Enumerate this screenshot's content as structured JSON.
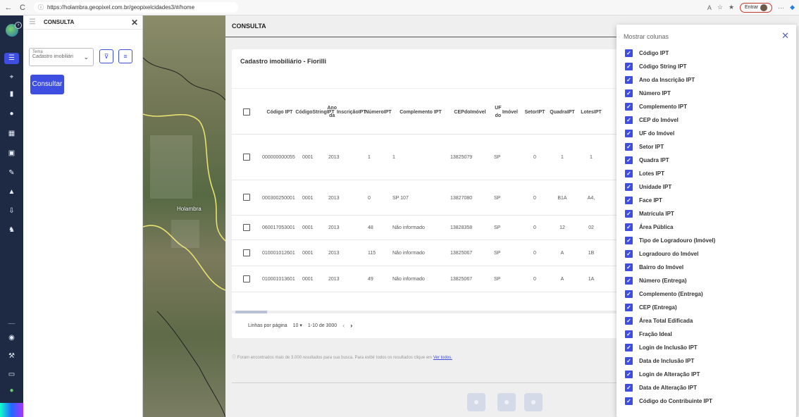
{
  "browser": {
    "url": "https://holambra.geopixel.com.br/geopixelcidades3/#/home",
    "sign_in_label": "Entrar",
    "more_label": "···"
  },
  "panel": {
    "title": "CONSULTA",
    "tema_label": "Tema",
    "tema_value": "Cadastro imobiliári",
    "consult_button": "Consultar"
  },
  "map": {
    "place_label": "Holambra"
  },
  "main": {
    "title": "CONSULTA",
    "card_title": "Cadastro imobiliário - Fiorilli",
    "columns": [
      {
        "lines": [
          "Código IPT"
        ]
      },
      {
        "lines": [
          "Código",
          "String",
          "IPT"
        ]
      },
      {
        "lines": [
          "Ano da",
          "Inscrição",
          "IPT"
        ]
      },
      {
        "lines": [
          "Número",
          "IPT"
        ]
      },
      {
        "lines": [
          "Complemento IPT"
        ]
      },
      {
        "lines": [
          "CEP",
          "do",
          "Imóvel"
        ]
      },
      {
        "lines": [
          "UF do",
          "Imóvel"
        ]
      },
      {
        "lines": [
          "Setor",
          "IPT"
        ]
      },
      {
        "lines": [
          "Quadra",
          "IPT"
        ]
      },
      {
        "lines": [
          "Lotes",
          "IPT"
        ]
      }
    ],
    "rows": [
      [
        "000000000055",
        "0001",
        "2013",
        "1",
        "1",
        "13825079",
        "SP",
        "0",
        "1",
        "1"
      ],
      [
        "000300250001",
        "0001",
        "2013",
        "0",
        "SP 107",
        "13827080",
        "SP",
        "0",
        "B1A",
        "A4,"
      ],
      [
        "060017053001",
        "0001",
        "2013",
        "48",
        "Não informado",
        "13828358",
        "SP",
        "0",
        "12",
        "02"
      ],
      [
        "010001012601",
        "0001",
        "2013",
        "115",
        "Não informado",
        "13825067",
        "SP",
        "0",
        "A",
        "1B"
      ],
      [
        "010001013601",
        "0001",
        "2013",
        "49",
        "Não informado",
        "13825067",
        "SP",
        "0",
        "A",
        "1A"
      ]
    ],
    "pager": {
      "rows_label": "Linhas por página",
      "rows_value": "10",
      "range": "1-10 de 3000"
    },
    "notice": {
      "text": "Foram encontrados mais de 3.000 resultados para sua busca. Para exibir todos os resultados clique em",
      "link": "Ver todos."
    }
  },
  "columns_panel": {
    "title": "Mostrar colunas",
    "items": [
      "Código IPT",
      "Código String IPT",
      "Ano da Inscrição IPT",
      "Número IPT",
      "Complemento IPT",
      "CEP do Imóvel",
      "UF do Imóvel",
      "Setor IPT",
      "Quadra IPT",
      "Lotes IPT",
      "Unidade IPT",
      "Face IPT",
      "Matrícula IPT",
      "Área Pública",
      "Tipo de Logradouro (Imóvel)",
      "Logradouro do Imóvel",
      "Bairro do Imóvel",
      "Número (Entrega)",
      "Complemento (Entrega)",
      "CEP (Entrega)",
      "Área Total Edificada",
      "Fração Ideal",
      "Login de Inclusão IPT",
      "Data de Inclusão IPT",
      "Login de Alteração IPT",
      "Data de Alteração IPT",
      "Código do Contribuinte IPT"
    ]
  },
  "icons": {
    "check": "✓",
    "back": "←",
    "reload": "C",
    "close": "✕",
    "chevron": "⌄",
    "next": "›",
    "prev": "‹"
  }
}
